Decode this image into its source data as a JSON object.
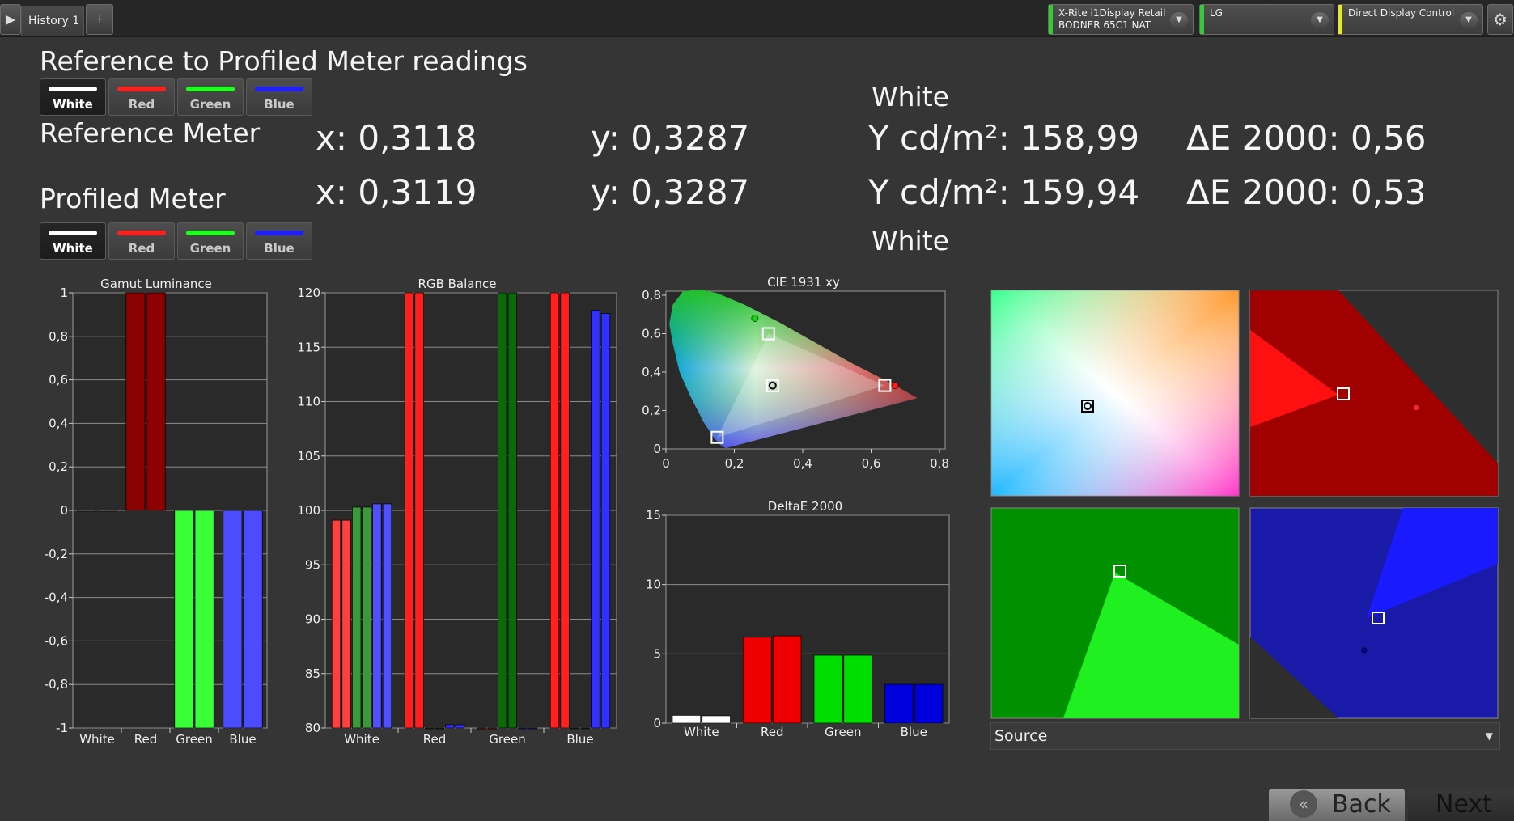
{
  "topbar": {
    "play_icon": "play-icon",
    "history_tab": "History 1",
    "add_tab_icon": "+",
    "meter1_line1": "X-Rite i1Display Retail",
    "meter1_line2": "BODNER 65C1 NAT",
    "meter1_color": "#33cc33",
    "meter2": "LG",
    "meter2_color": "#33cc33",
    "meter3": "Direct Display Control",
    "meter3_color": "#e6e633",
    "chevron": "▼",
    "gear": "⚙"
  },
  "heading": "Reference to Profiled Meter readings",
  "tabs": [
    {
      "label": "White",
      "color": "#ffffff"
    },
    {
      "label": "Red",
      "color": "#ff2020"
    },
    {
      "label": "Green",
      "color": "#20ff20"
    },
    {
      "label": "Blue",
      "color": "#2020ff"
    }
  ],
  "selected_tab": "White",
  "readings": {
    "top_label": "White",
    "bottom_label": "White",
    "reference": {
      "label": "Reference Meter",
      "x": "x: 0,3118",
      "y": "y: 0,3287",
      "Y": "Y cd/m²: 158,99",
      "dE": "ΔE 2000: 0,56"
    },
    "profiled": {
      "label": "Profiled Meter",
      "x": "x: 0,3119",
      "y": "y: 0,3287",
      "Y": "Y cd/m²: 159,94",
      "dE": "ΔE 2000: 0,53"
    }
  },
  "chart_data": [
    {
      "type": "bar",
      "title": "Gamut Luminance",
      "categories": [
        "White",
        "Red",
        "Green",
        "Blue"
      ],
      "series": [
        {
          "values": [
            0,
            1,
            -1,
            -1
          ]
        },
        {
          "values": [
            0,
            1,
            -1,
            -1
          ]
        }
      ],
      "colors": [
        "#ffffff",
        "#8b0000",
        "#39ff39",
        "#4c4cff"
      ],
      "ylim": [
        -1,
        1
      ],
      "yticks": [
        "1",
        "0,8",
        "0,6",
        "0,4",
        "0,2",
        "0",
        "-0,2",
        "-0,4",
        "-0,6",
        "-0,8",
        "-1"
      ]
    },
    {
      "type": "bar",
      "title": "RGB Balance",
      "categories": [
        "White",
        "Red",
        "Green",
        "Blue"
      ],
      "series": [
        {
          "values": [
            99.1,
            120,
            80,
            120
          ]
        },
        {
          "values": [
            99.1,
            120,
            80,
            120
          ]
        },
        {
          "values": [
            100.3,
            80,
            120,
            80
          ]
        },
        {
          "values": [
            100.3,
            80,
            120,
            80
          ]
        },
        {
          "values": [
            100.6,
            80.3,
            80,
            118.4
          ]
        },
        {
          "values": [
            100.6,
            80.3,
            80,
            118.1
          ]
        }
      ],
      "ylim": [
        80,
        120
      ],
      "yticks": [
        "120",
        "115",
        "110",
        "105",
        "100",
        "95",
        "90",
        "85",
        "80"
      ]
    },
    {
      "type": "scatter",
      "title": "CIE 1931 xy",
      "xlim": [
        0,
        0.8
      ],
      "ylim": [
        0,
        0.8
      ],
      "xticks": [
        "0",
        "0,2",
        "0,4",
        "0,6",
        "0,8"
      ],
      "yticks": [
        "0,8",
        "0,6",
        "0,4",
        "0,2",
        "0"
      ],
      "points": [
        {
          "name": "white",
          "x": 0.312,
          "y": 0.329
        },
        {
          "name": "red",
          "x": 0.64,
          "y": 0.33
        },
        {
          "name": "green",
          "x": 0.3,
          "y": 0.6
        },
        {
          "name": "blue",
          "x": 0.15,
          "y": 0.06
        },
        {
          "name": "red-measured",
          "x": 0.67,
          "y": 0.33
        },
        {
          "name": "green-measured",
          "x": 0.26,
          "y": 0.68
        },
        {
          "name": "white-measured",
          "x": 0.312,
          "y": 0.33
        }
      ]
    },
    {
      "type": "bar",
      "title": "DeltaE 2000",
      "categories": [
        "White",
        "Red",
        "Green",
        "Blue"
      ],
      "series": [
        {
          "values": [
            0.56,
            6.2,
            4.9,
            2.8
          ]
        },
        {
          "values": [
            0.53,
            6.3,
            4.9,
            2.8
          ]
        }
      ],
      "colors": [
        "#ffffff",
        "#ee0000",
        "#00dd00",
        "#0000dd"
      ],
      "ylim": [
        0,
        15
      ],
      "yticks": [
        "15",
        "10",
        "5",
        "0"
      ]
    }
  ],
  "source_select": "Source",
  "nav": {
    "back": "Back",
    "next": "Next"
  }
}
